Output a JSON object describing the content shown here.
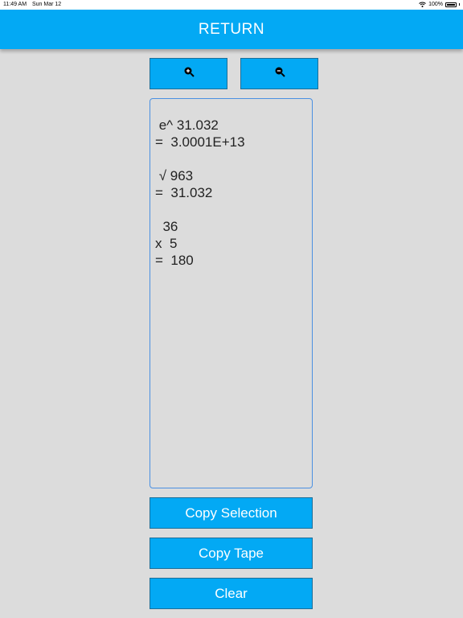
{
  "status_bar": {
    "time": "11:49 AM",
    "date": "Sun Mar 12",
    "battery": "100%"
  },
  "header": {
    "title": "RETURN",
    "color": "#03a9f4"
  },
  "zoom": {
    "in_icon": "zoom-in-icon",
    "out_icon": "zoom-out-icon"
  },
  "tape": {
    "lines": [
      " e^ 31.032",
      "=  3.0001E+13",
      "",
      " √ 963",
      "=  31.032",
      "",
      "  36",
      "x  5",
      "=  180"
    ]
  },
  "buttons": {
    "copy_selection": "Copy Selection",
    "copy_tape": "Copy Tape",
    "clear": "Clear"
  }
}
